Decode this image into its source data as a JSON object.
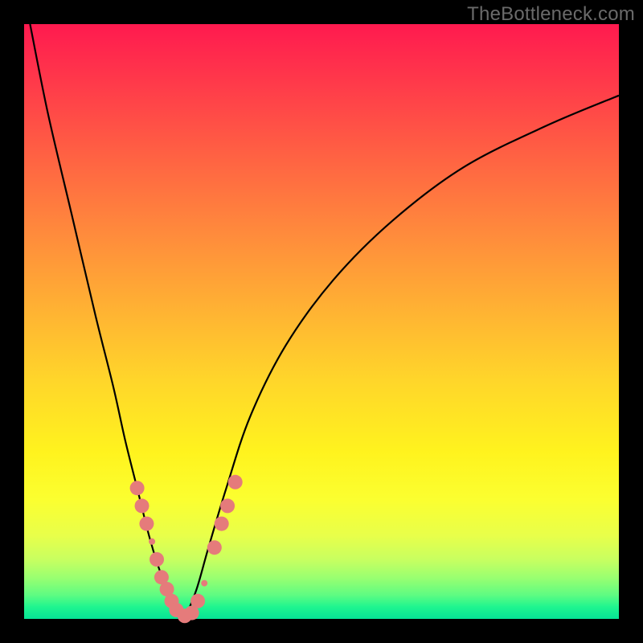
{
  "watermark": "TheBottleneck.com",
  "colors": {
    "frame_bg_top": "#ff1a4f",
    "frame_bg_bottom": "#06e496",
    "curve": "#000000",
    "bead": "#e57b7b",
    "page_bg": "#000000",
    "watermark": "#6a6a6a"
  },
  "chart_data": {
    "type": "line",
    "title": "",
    "xlabel": "",
    "ylabel": "",
    "xlim": [
      0,
      100
    ],
    "ylim": [
      0,
      100
    ],
    "grid": false,
    "legend": false,
    "series": [
      {
        "name": "left-branch",
        "x": [
          1,
          4,
          8,
          12,
          15,
          17,
          19,
          21,
          22.5,
          24,
          25.5,
          27
        ],
        "y": [
          100,
          85,
          68,
          51,
          39,
          30,
          22,
          14,
          9,
          5,
          2,
          0
        ]
      },
      {
        "name": "right-branch",
        "x": [
          27,
          29,
          31,
          34,
          38,
          44,
          52,
          62,
          74,
          88,
          100
        ],
        "y": [
          0,
          5,
          12,
          22,
          34,
          46,
          57,
          67,
          76,
          83,
          88
        ]
      }
    ],
    "markers": [
      {
        "series": "left-branch",
        "x": 19.0,
        "y": 22,
        "size": "large"
      },
      {
        "series": "left-branch",
        "x": 19.8,
        "y": 19,
        "size": "large"
      },
      {
        "series": "left-branch",
        "x": 20.6,
        "y": 16,
        "size": "large"
      },
      {
        "series": "left-branch",
        "x": 22.3,
        "y": 10,
        "size": "large"
      },
      {
        "series": "left-branch",
        "x": 23.1,
        "y": 7,
        "size": "large"
      },
      {
        "series": "left-branch",
        "x": 24.0,
        "y": 5,
        "size": "large"
      },
      {
        "series": "left-branch",
        "x": 24.8,
        "y": 3,
        "size": "large"
      },
      {
        "series": "left-branch",
        "x": 25.6,
        "y": 1.5,
        "size": "large"
      },
      {
        "series": "left-branch",
        "x": 27.0,
        "y": 0.5,
        "size": "large"
      },
      {
        "series": "right-branch",
        "x": 28.2,
        "y": 1.0,
        "size": "large"
      },
      {
        "series": "right-branch",
        "x": 29.2,
        "y": 3.0,
        "size": "large"
      },
      {
        "series": "right-branch",
        "x": 32.0,
        "y": 12,
        "size": "large"
      },
      {
        "series": "right-branch",
        "x": 33.2,
        "y": 16,
        "size": "large"
      },
      {
        "series": "right-branch",
        "x": 34.2,
        "y": 19,
        "size": "large"
      },
      {
        "series": "right-branch",
        "x": 35.5,
        "y": 23,
        "size": "large"
      },
      {
        "series": "left-branch",
        "x": 21.5,
        "y": 13,
        "size": "small"
      },
      {
        "series": "right-branch",
        "x": 30.3,
        "y": 6,
        "size": "small"
      }
    ],
    "annotations": []
  }
}
